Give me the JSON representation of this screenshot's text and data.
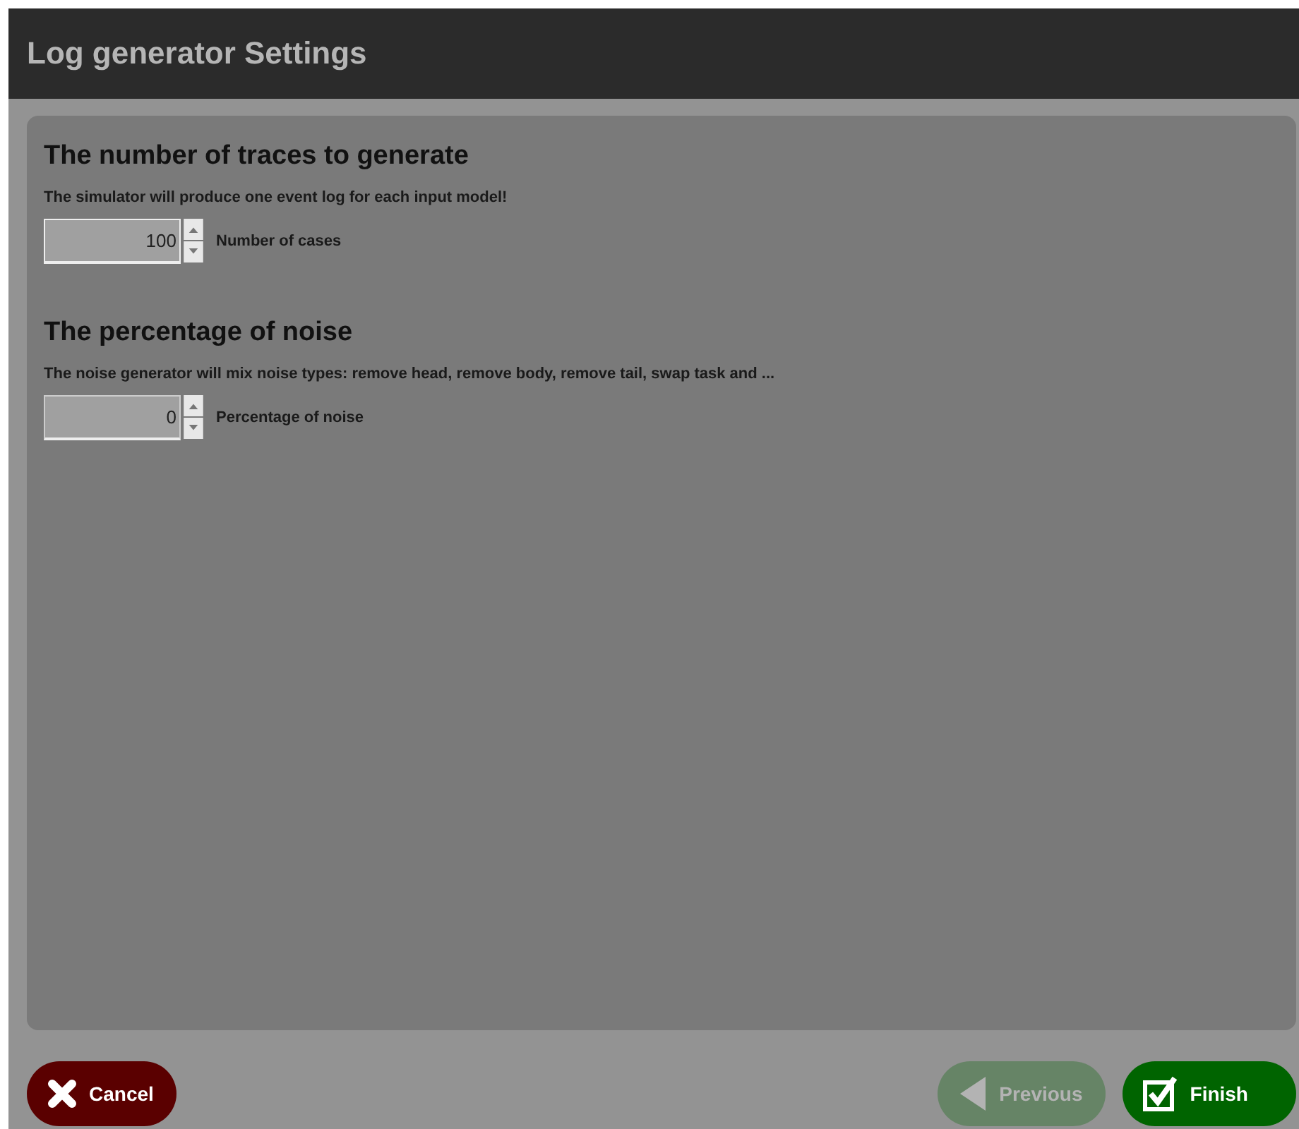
{
  "window": {
    "title": "Log generator Settings"
  },
  "sections": [
    {
      "heading": "The number of traces to generate",
      "description": "The simulator will produce one event log for each input model!",
      "spinner": {
        "value": "100",
        "label": "Number of cases",
        "focused": true
      }
    },
    {
      "heading": "The percentage of noise",
      "description": "The noise generator will mix noise types: remove head, remove body, remove tail, swap task and ...",
      "spinner": {
        "value": "0",
        "label": "Percentage of noise",
        "focused": false
      }
    }
  ],
  "buttons": [
    {
      "label": "Cancel",
      "kind": "cancel",
      "disabled": false
    },
    {
      "label": "Previous",
      "kind": "previous",
      "disabled": true
    },
    {
      "label": "Finish",
      "kind": "finish",
      "disabled": false
    }
  ]
}
